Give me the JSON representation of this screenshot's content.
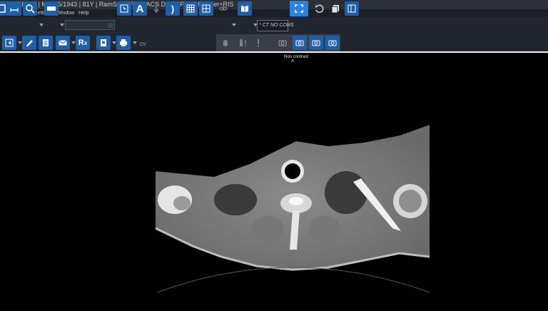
{
  "title_bar": {
    "text": "/11A^USER | M | 6/5/1943 | 81Y | RamSoft - RIS PACS Demo PowerReader+RIS"
  },
  "menu": {
    "items": [
      "Settings",
      "RIS Settings",
      "Window",
      "Help"
    ]
  },
  "toolbar": {
    "protocol_combo": "* CT NO CONS",
    "annotation_text_button": "A",
    "text_cv": "CV"
  },
  "viewer": {
    "series_label": "Non contrast",
    "orientation_label": "A"
  },
  "icons": [
    "layout-icon",
    "measure-icon",
    "zoom-icon",
    "window-level-icon",
    "select-icon",
    "text-annotation-icon",
    "arrow-icon",
    "bracket-icon",
    "grid-icon",
    "tile-icon",
    "link-icon",
    "book-icon",
    "fullscreen-icon",
    "undo-icon",
    "copy-icon",
    "panel-icon",
    "sidebar-icon",
    "pen-icon",
    "report-icon",
    "email-icon",
    "rx-icon",
    "document-icon",
    "print-icon",
    "bell-icon",
    "person-alert-icon",
    "exclamation-icon",
    "camera-icon"
  ],
  "colors": {
    "accent": "#2a82e0",
    "toolbar_bg": "#22272e",
    "viewport_bg": "#000000"
  }
}
